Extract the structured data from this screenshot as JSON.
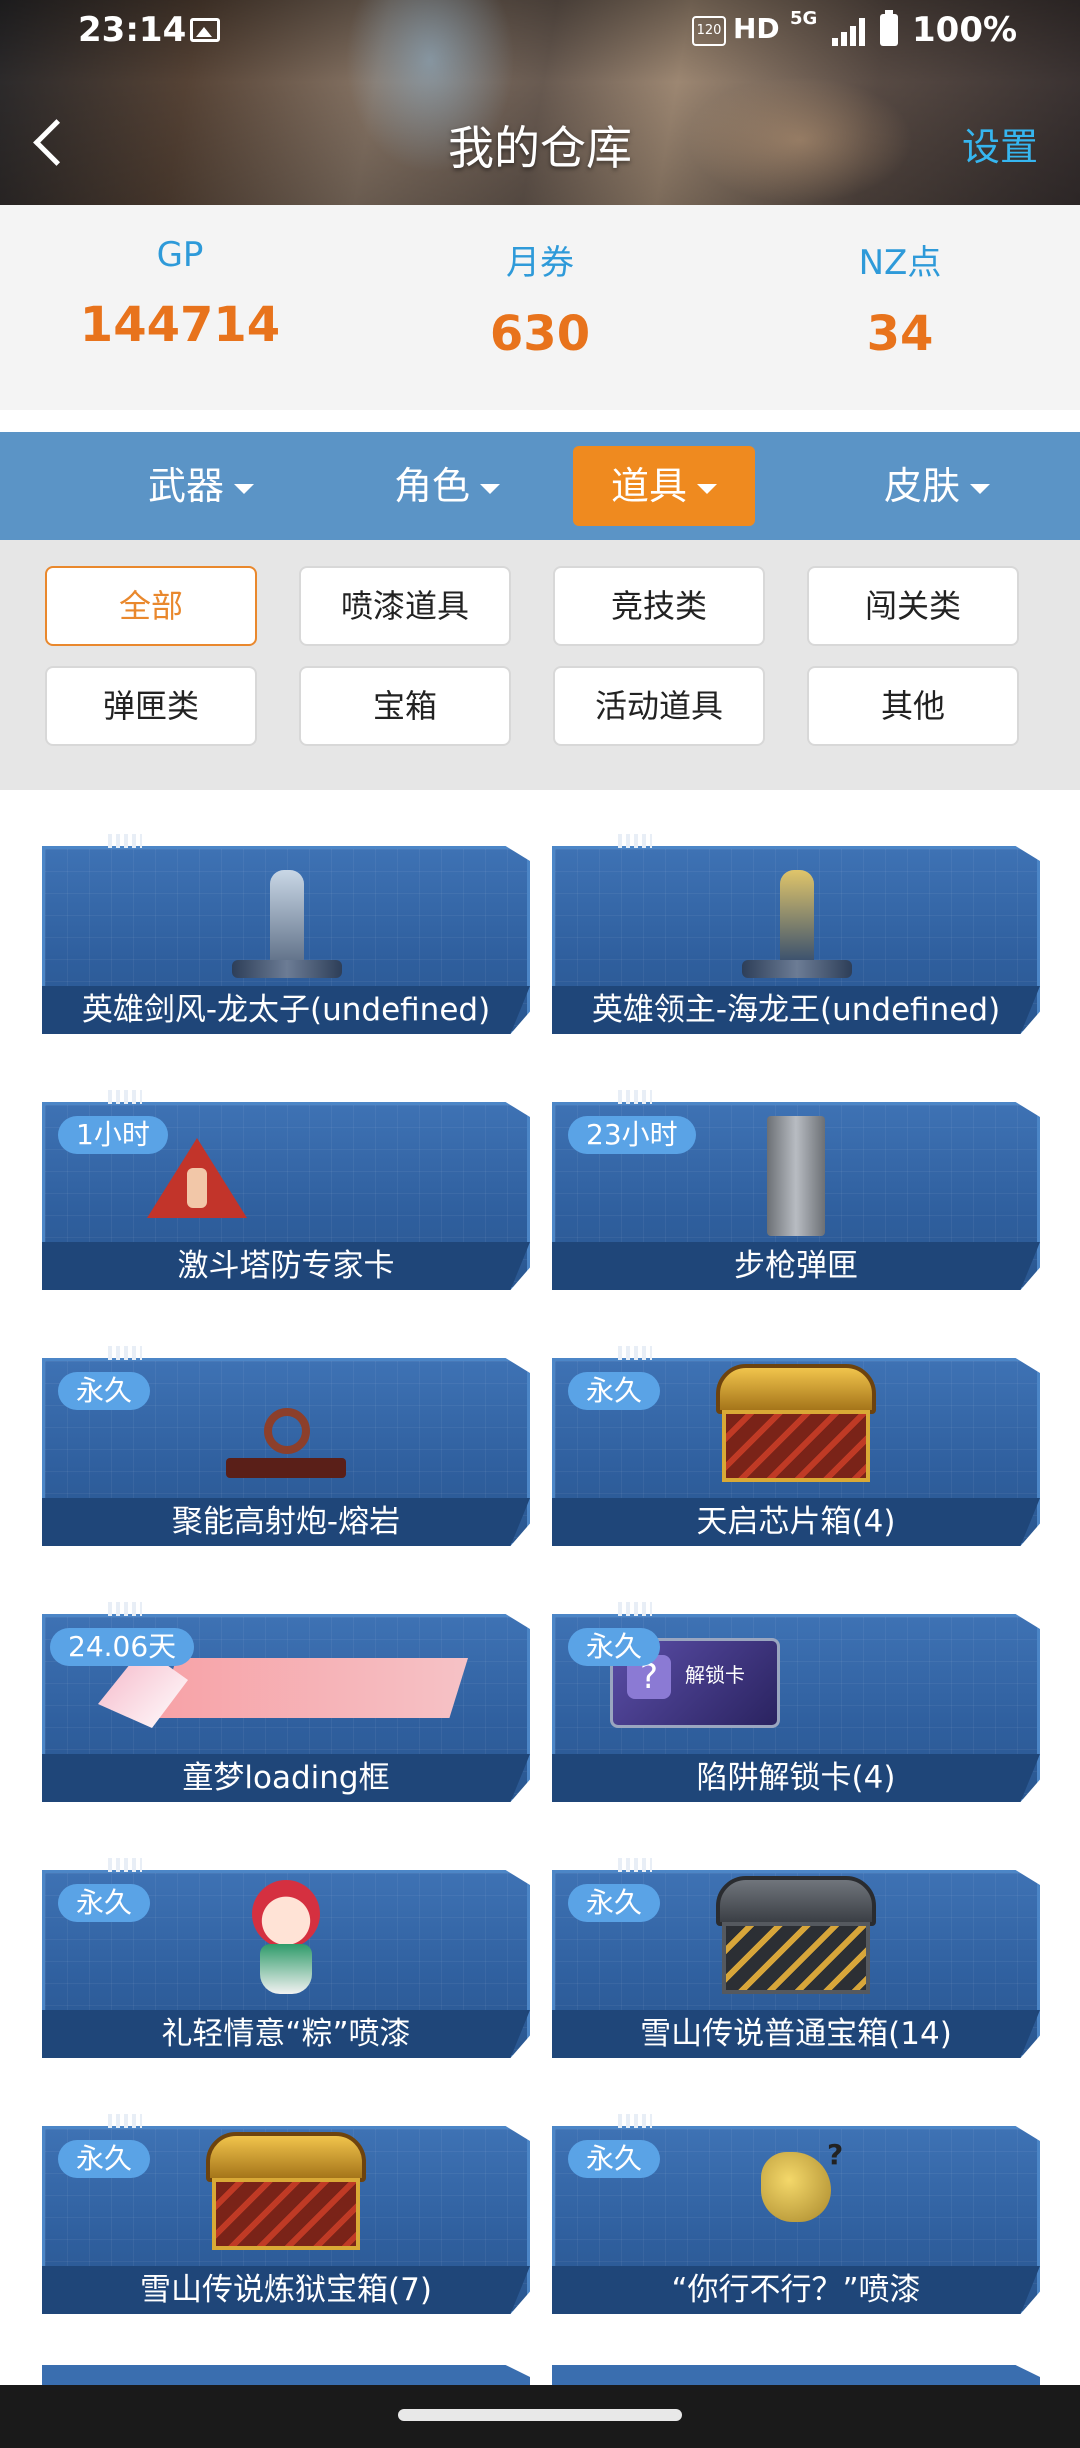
{
  "status_bar": {
    "time": "23:14",
    "network_rate": "120 Hz",
    "hd": "HD",
    "network": "5G",
    "battery": "100%"
  },
  "header": {
    "title": "我的仓库",
    "settings_label": "设置",
    "back_icon": "chevron-left-icon"
  },
  "currency": [
    {
      "label": "GP",
      "value": "144714"
    },
    {
      "label": "月券",
      "value": "630"
    },
    {
      "label": "NZ点",
      "value": "34"
    }
  ],
  "tabs": [
    {
      "label": "武器",
      "active": false
    },
    {
      "label": "角色",
      "active": false
    },
    {
      "label": "道具",
      "active": true
    },
    {
      "label": "皮肤",
      "active": false
    }
  ],
  "filters": [
    {
      "label": "全部",
      "active": true
    },
    {
      "label": "喷漆道具",
      "active": false
    },
    {
      "label": "竞技类",
      "active": false
    },
    {
      "label": "闯关类",
      "active": false
    },
    {
      "label": "弹匣类",
      "active": false
    },
    {
      "label": "宝箱",
      "active": false
    },
    {
      "label": "活动道具",
      "active": false
    },
    {
      "label": "其他",
      "active": false
    }
  ],
  "items": [
    {
      "name": "英雄剑风-龙太子(undefined)",
      "badge": "",
      "image": "hero-figure"
    },
    {
      "name": "英雄领主-海龙王(undefined)",
      "badge": "",
      "image": "hero-figure-gold"
    },
    {
      "name": "激斗塔防专家卡",
      "badge": "1小时",
      "image": "warning-card"
    },
    {
      "name": "步枪弹匣",
      "badge": "23小时",
      "image": "rifle-magazine"
    },
    {
      "name": "聚能高射炮-熔岩",
      "badge": "永久",
      "image": "turret"
    },
    {
      "name": "天启芯片箱(4)",
      "badge": "永久",
      "image": "gold-chest"
    },
    {
      "name": "童梦loading框",
      "badge": "24.06天",
      "image": "loading-frame"
    },
    {
      "name": "陷阱解锁卡(4)",
      "badge": "永久",
      "image": "unlock-card"
    },
    {
      "name": "礼轻情意“粽”喷漆",
      "badge": "永久",
      "image": "spray-girl"
    },
    {
      "name": "雪山传说普通宝箱(14)",
      "badge": "永久",
      "image": "dark-chest"
    },
    {
      "name": "雪山传说炼狱宝箱(7)",
      "badge": "永久",
      "image": "gold-chest"
    },
    {
      "name": "“你行不行？”喷漆",
      "badge": "永久",
      "image": "spray-bird"
    }
  ],
  "unlock_card_text": "解锁卡",
  "unlock_card_question": "?",
  "colors": {
    "accent": "#ef8a1f",
    "tab_bar": "#5b94c6",
    "currency_label": "#2e9ad9",
    "currency_value": "#e8731c",
    "settings": "#36b6f0"
  }
}
